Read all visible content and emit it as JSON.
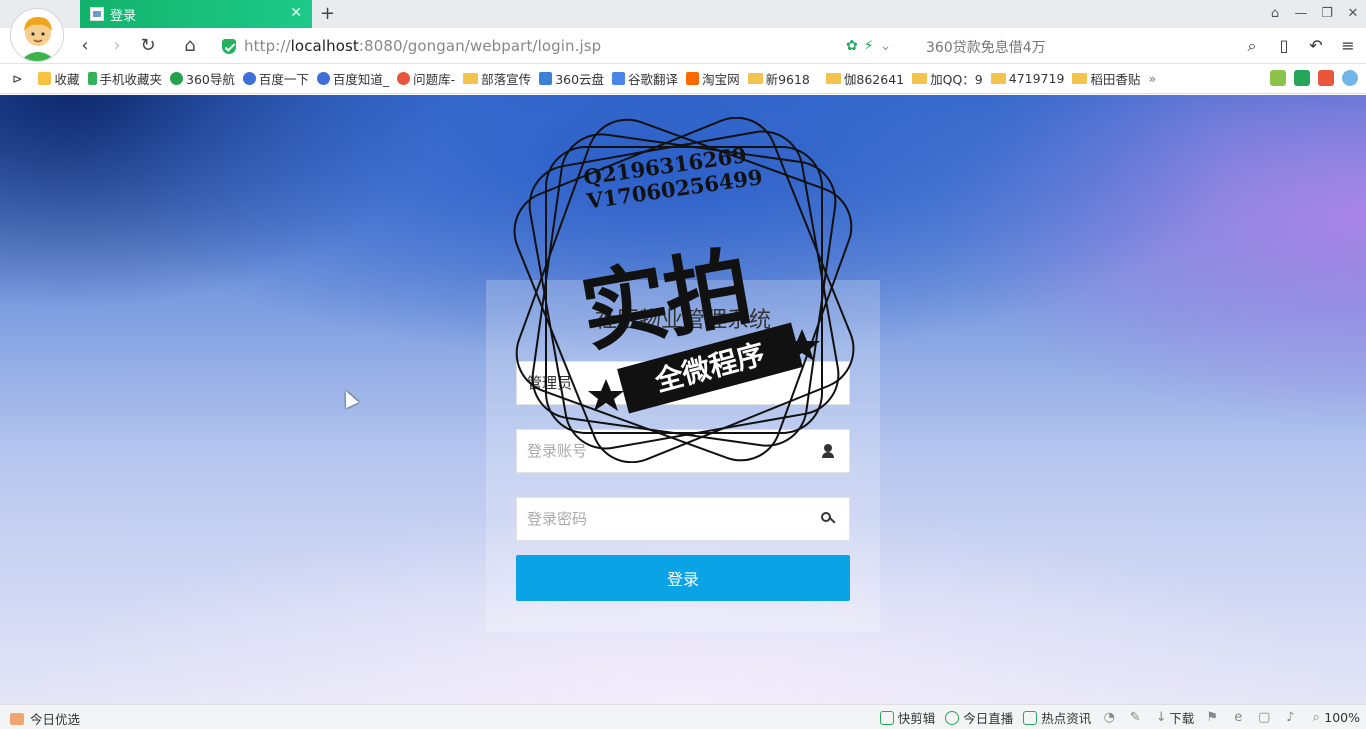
{
  "browser": {
    "tab_title": "登录",
    "url_prefix": "http://",
    "url_host": "localhost",
    "url_rest": ":8080/gongan/webpart/login.jsp",
    "search_hint": "360贷款免息借4万",
    "close_glyph": "✕",
    "new_tab_glyph": "+"
  },
  "bookmarks": [
    {
      "label": "收藏",
      "color": "#f5c242"
    },
    {
      "label": "手机收藏夹",
      "color": "#33b15b"
    },
    {
      "label": "360导航",
      "color": "#25a34c"
    },
    {
      "label": "百度一下",
      "color": "#3f6fd8"
    },
    {
      "label": "百度知道_",
      "color": "#3f6fd8"
    },
    {
      "label": "问题库-",
      "color": "#e8553b"
    },
    {
      "label": "部落宣传",
      "color": "folder"
    },
    {
      "label": "360云盘",
      "color": "#3b82d6"
    },
    {
      "label": "谷歌翻译",
      "color": "#4a86e8"
    },
    {
      "label": "淘宝网",
      "color": "#ff6a00"
    },
    {
      "label": "新9618",
      "color": "folder"
    },
    {
      "label": "伽862641",
      "color": "folder"
    },
    {
      "label": "加QQ：9",
      "color": "folder"
    },
    {
      "label": "4719719",
      "color": "folder"
    },
    {
      "label": "稻田香贴",
      "color": "folder"
    }
  ],
  "bookmarks_more": "»",
  "login": {
    "title": "社区物业管理系统",
    "role_selected": "管理员",
    "account_placeholder": "登录账号",
    "password_placeholder": "登录密码",
    "submit_label": "登录"
  },
  "watermark": {
    "line1": "Q2196316269",
    "line2": "V17060256499",
    "big": "实拍",
    "ribbon": "全微程序"
  },
  "statusbar": {
    "left_label": "今日优选",
    "items": [
      "快剪辑",
      "今日直播",
      "热点资讯"
    ],
    "download_label": "下载",
    "zoom": "100%"
  },
  "colors": {
    "tab_green": "#12b36b",
    "login_button": "#09a3e6"
  }
}
